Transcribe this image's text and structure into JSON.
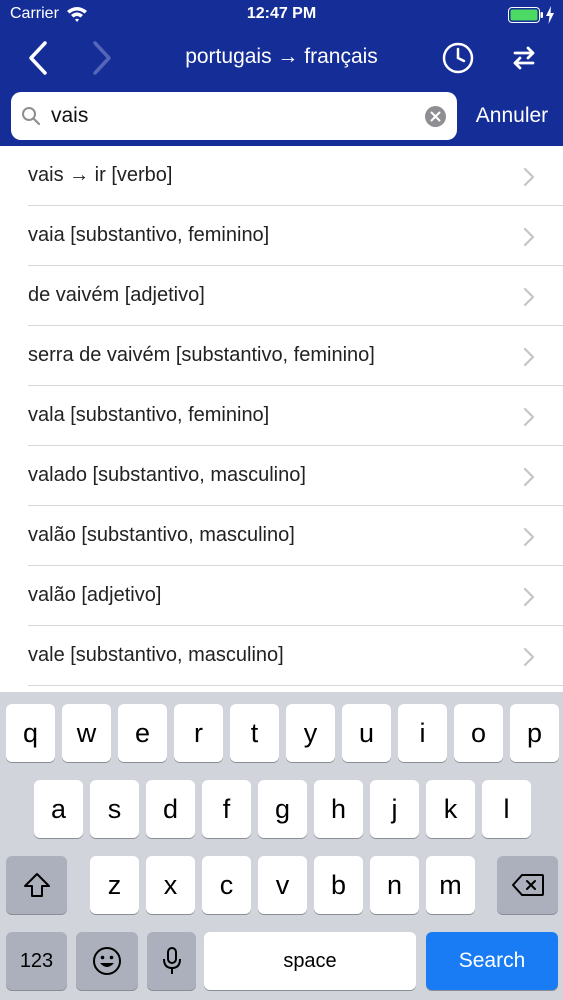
{
  "status_bar": {
    "carrier": "Carrier",
    "time": "12:47 PM"
  },
  "nav": {
    "title": "portugais → français",
    "back_icon": "chevron-left-icon",
    "forward_icon": "chevron-right-icon",
    "history_icon": "clock-icon",
    "swap_icon": "swap-icon"
  },
  "search": {
    "value": "vais",
    "placeholder": "",
    "cancel_label": "Annuler"
  },
  "results": [
    {
      "label": "vais → ir [verbo]"
    },
    {
      "label": "vaia [substantivo, feminino]"
    },
    {
      "label": "de vaivém [adjetivo]"
    },
    {
      "label": "serra de vaivém [substantivo, feminino]"
    },
    {
      "label": "vala [substantivo, feminino]"
    },
    {
      "label": "valado [substantivo, masculino]"
    },
    {
      "label": "valão [substantivo, masculino]"
    },
    {
      "label": "valão [adjetivo]"
    },
    {
      "label": "vale [substantivo, masculino]"
    }
  ],
  "keyboard": {
    "row1": [
      "q",
      "w",
      "e",
      "r",
      "t",
      "y",
      "u",
      "i",
      "o",
      "p"
    ],
    "row2": [
      "a",
      "s",
      "d",
      "f",
      "g",
      "h",
      "j",
      "k",
      "l"
    ],
    "row3": [
      "z",
      "x",
      "c",
      "v",
      "b",
      "n",
      "m"
    ],
    "numbers_label": "123",
    "space_label": "space",
    "search_label": "Search"
  },
  "colors": {
    "nav_background": "#152d96",
    "search_key": "#1a7cf5",
    "keyboard_background": "#d1d4db"
  }
}
